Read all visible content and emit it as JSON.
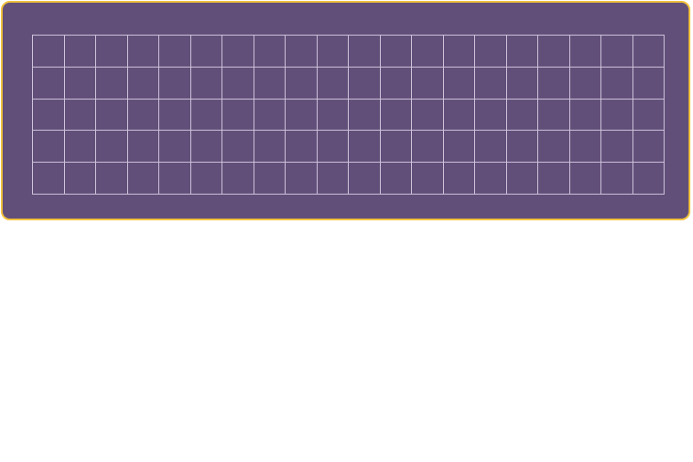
{
  "panel": {
    "background_color": "#624f79",
    "border_color": "#f3c23c",
    "grid_line_color": "#cfc4dc"
  },
  "grid": {
    "columns": 20,
    "rows": 5
  }
}
